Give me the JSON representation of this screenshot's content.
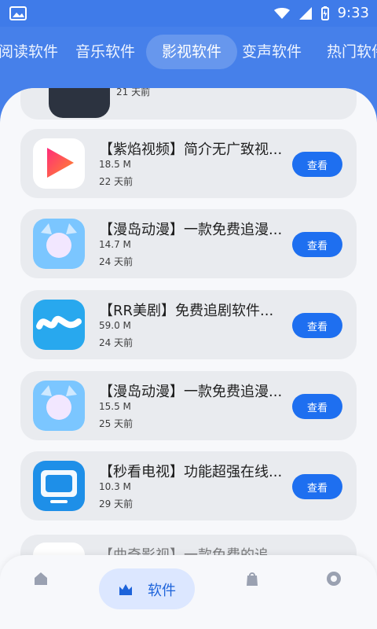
{
  "status": {
    "time": "9:33"
  },
  "tabs": [
    {
      "label": "阅读软件"
    },
    {
      "label": "音乐软件"
    },
    {
      "label": "影视软件"
    },
    {
      "label": "变声软件"
    },
    {
      "label": "热门软件"
    }
  ],
  "top_partial": {
    "days": "21 天前"
  },
  "items": [
    {
      "title": "【紫焰视频】简介无广致视...",
      "size": "18.5 M",
      "days": "22 天前",
      "action": "查看"
    },
    {
      "title": "【漫岛动漫】一款免费追漫...",
      "size": "14.7 M",
      "days": "24 天前",
      "action": "查看"
    },
    {
      "title": "【RR美剧】免费追剧软件...",
      "size": "59.0 M",
      "days": "24 天前",
      "action": "查看"
    },
    {
      "title": "【漫岛动漫】一款免费追漫...",
      "size": "15.5 M",
      "days": "25 天前",
      "action": "查看"
    },
    {
      "title": "【秒看电视】功能超强在线...",
      "size": "10.3 M",
      "days": "29 天前",
      "action": "查看"
    }
  ],
  "bottom_partial": {
    "title": "【曲奇影视】一款免费的追..."
  },
  "bottom_nav": {
    "active_label": "软件"
  },
  "colors": {
    "accent": "#1e6ff0",
    "header": "#4680ea"
  },
  "icons": {
    "status_left": "image-icon",
    "wifi": "wifi-icon",
    "signal": "signal-icon",
    "battery": "battery-icon",
    "home": "home-icon",
    "software": "software-icon",
    "bag": "bag-icon",
    "settings": "settings-icon"
  }
}
